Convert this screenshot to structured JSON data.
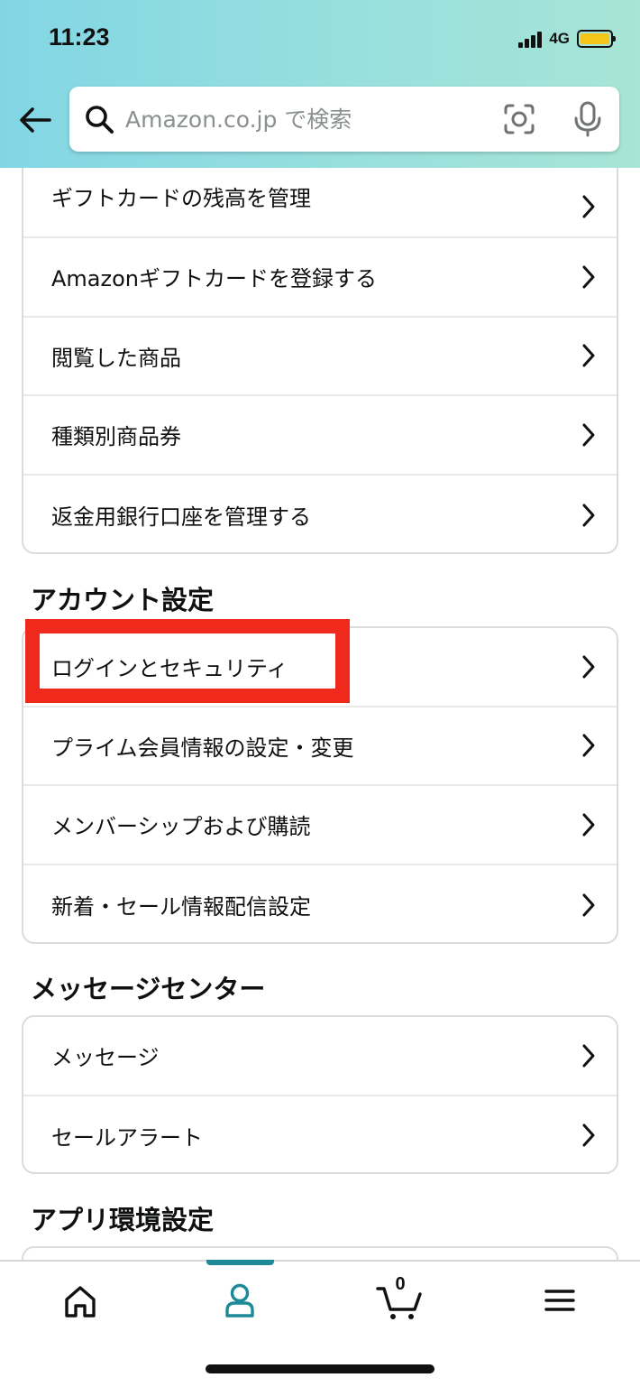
{
  "status_bar": {
    "time": "11:23",
    "network": "4G"
  },
  "colors": {
    "accent": "#1f8a97",
    "highlight": "#ef2a1d",
    "battery": "#f5c518",
    "header_gradient": [
      "#82d6e4",
      "#a7e5d6"
    ]
  },
  "search": {
    "placeholder": "Amazon.co.jp で検索"
  },
  "icons": {
    "back": "arrow-left-icon",
    "search": "search-icon",
    "camera": "camera-lens-icon",
    "mic": "microphone-icon",
    "chevron": "chevron-right-icon",
    "home": "home-icon",
    "account": "account-icon",
    "cart": "cart-icon",
    "menu": "menu-icon"
  },
  "payment_items": [
    {
      "label": "ギフトカードの残高を管理"
    },
    {
      "label": "Amazonギフトカードを登録する"
    },
    {
      "label": "閲覧した商品"
    },
    {
      "label": "種類別商品券"
    },
    {
      "label": "返金用銀行口座を管理する"
    }
  ],
  "account_settings": {
    "title": "アカウント設定",
    "items": [
      {
        "label": "ログインとセキュリティ",
        "highlighted": true
      },
      {
        "label": "プライム会員情報の設定・変更"
      },
      {
        "label": "メンバーシップおよび購読"
      },
      {
        "label": "新着・セール情報配信設定"
      }
    ]
  },
  "message_center": {
    "title": "メッセージセンター",
    "items": [
      {
        "label": "メッセージ"
      },
      {
        "label": "セールアラート"
      }
    ]
  },
  "app_settings": {
    "title": "アプリ環境設定"
  },
  "bottom_nav": {
    "active": "account",
    "cart_count": "0"
  }
}
